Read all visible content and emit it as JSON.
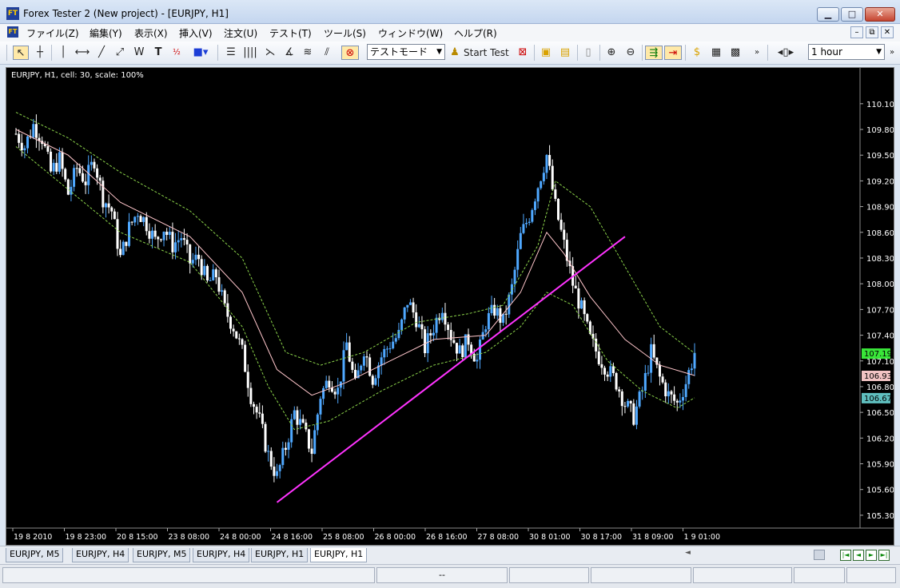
{
  "window": {
    "title": "Forex Tester 2  (New project) - [EURJPY, H1]",
    "app_icon_text": "FT",
    "buttons": {
      "minimize": "▁",
      "maximize": "□",
      "close": "✕"
    }
  },
  "menu": {
    "items": [
      "ファイル(Z)",
      "編集(Y)",
      "表示(X)",
      "挿入(V)",
      "注文(U)",
      "テスト(T)",
      "ツール(S)",
      "ウィンドウ(W)",
      "ヘルプ(R)"
    ],
    "mdi_buttons": [
      "–",
      "⧉",
      "✕"
    ]
  },
  "toolbar": {
    "text_tool_label": "T",
    "mode_select": "テストモード",
    "start_test_label": "Start Test",
    "timeframe_select": "1 hour"
  },
  "chart": {
    "info": "EURJPY, H1, cell: 30, scale: 100%"
  },
  "chart_data": {
    "type": "candlestick",
    "symbol": "EURJPY",
    "timeframe": "H1",
    "y_ticks": [
      "110.10",
      "109.80",
      "109.50",
      "109.20",
      "108.90",
      "108.60",
      "108.30",
      "108.00",
      "107.70",
      "107.40",
      "107.10",
      "106.80",
      "106.50",
      "106.20",
      "105.90",
      "105.60",
      "105.30"
    ],
    "ylim": [
      105.15,
      110.35
    ],
    "x_ticks": [
      "19 8 2010",
      "19 8 23:00",
      "20 8 15:00",
      "23 8 08:00",
      "24 8 00:00",
      "24 8 16:00",
      "25 8 08:00",
      "26 8 00:00",
      "26 8 16:00",
      "27 8 08:00",
      "30 8 01:00",
      "30 8 17:00",
      "31 8 09:00",
      "1 9 01:00"
    ],
    "price_labels": [
      {
        "text": "107.19",
        "value": 107.19,
        "color": "#39e639"
      },
      {
        "text": "106.93",
        "value": 106.93,
        "color": "#f2c4c4"
      },
      {
        "text": "106.67",
        "value": 106.67,
        "color": "#5fbfbf"
      }
    ],
    "close_path": [
      [
        0,
        109.75
      ],
      [
        1,
        109.6
      ],
      [
        2,
        109.85
      ],
      [
        3,
        109.7
      ],
      [
        4,
        109.3
      ],
      [
        5,
        109.45
      ],
      [
        6,
        109.05
      ],
      [
        7,
        109.35
      ],
      [
        8,
        109.2
      ],
      [
        9,
        109.45
      ],
      [
        10,
        109.0
      ],
      [
        11,
        108.85
      ],
      [
        12,
        108.3
      ],
      [
        13,
        108.65
      ],
      [
        14,
        108.85
      ],
      [
        15,
        108.7
      ],
      [
        16,
        108.5
      ],
      [
        17,
        108.65
      ],
      [
        18,
        108.45
      ],
      [
        19,
        108.55
      ],
      [
        20,
        108.25
      ],
      [
        21,
        108.3
      ],
      [
        22,
        108.0
      ],
      [
        23,
        108.1
      ],
      [
        24,
        107.7
      ],
      [
        25,
        107.5
      ],
      [
        26,
        107.2
      ],
      [
        27,
        106.7
      ],
      [
        28,
        106.4
      ],
      [
        29,
        106.0
      ],
      [
        30,
        105.75
      ],
      [
        31,
        106.1
      ],
      [
        32,
        106.5
      ],
      [
        33,
        106.3
      ],
      [
        34,
        106.05
      ],
      [
        35,
        106.7
      ],
      [
        36,
        106.9
      ],
      [
        37,
        106.75
      ],
      [
        38,
        107.3
      ],
      [
        39,
        106.8
      ],
      [
        40,
        107.25
      ],
      [
        41,
        106.9
      ],
      [
        42,
        107.15
      ],
      [
        43,
        107.3
      ],
      [
        44,
        107.4
      ],
      [
        45,
        107.8
      ],
      [
        46,
        107.6
      ],
      [
        47,
        107.25
      ],
      [
        48,
        107.5
      ],
      [
        49,
        107.75
      ],
      [
        50,
        107.4
      ],
      [
        51,
        107.2
      ],
      [
        52,
        107.35
      ],
      [
        53,
        107.1
      ],
      [
        54,
        107.55
      ],
      [
        55,
        107.7
      ],
      [
        56,
        107.55
      ],
      [
        57,
        107.95
      ],
      [
        58,
        108.55
      ],
      [
        59,
        108.8
      ],
      [
        60,
        109.15
      ],
      [
        61,
        109.5
      ],
      [
        62,
        108.9
      ],
      [
        63,
        108.45
      ],
      [
        64,
        108.0
      ],
      [
        65,
        107.7
      ],
      [
        66,
        107.35
      ],
      [
        67,
        107.15
      ],
      [
        68,
        107.0
      ],
      [
        69,
        106.85
      ],
      [
        70,
        106.6
      ],
      [
        71,
        106.45
      ],
      [
        72,
        106.75
      ],
      [
        73,
        107.2
      ],
      [
        74,
        106.9
      ],
      [
        75,
        106.7
      ],
      [
        76,
        106.6
      ],
      [
        77,
        106.85
      ],
      [
        78,
        107.2
      ]
    ],
    "moving_average": [
      [
        0,
        109.8
      ],
      [
        6,
        109.5
      ],
      [
        12,
        108.95
      ],
      [
        20,
        108.55
      ],
      [
        26,
        107.9
      ],
      [
        30,
        107.0
      ],
      [
        34,
        106.7
      ],
      [
        38,
        106.85
      ],
      [
        42,
        107.05
      ],
      [
        48,
        107.35
      ],
      [
        54,
        107.4
      ],
      [
        58,
        107.9
      ],
      [
        61,
        108.6
      ],
      [
        63,
        108.35
      ],
      [
        66,
        107.85
      ],
      [
        70,
        107.35
      ],
      [
        74,
        107.05
      ],
      [
        78,
        106.93
      ]
    ],
    "band_upper": [
      [
        0,
        110.0
      ],
      [
        6,
        109.7
      ],
      [
        12,
        109.3
      ],
      [
        20,
        108.85
      ],
      [
        26,
        108.3
      ],
      [
        31,
        107.2
      ],
      [
        35,
        107.05
      ],
      [
        40,
        107.2
      ],
      [
        46,
        107.55
      ],
      [
        52,
        107.65
      ],
      [
        56,
        107.75
      ],
      [
        60,
        108.45
      ],
      [
        62,
        109.2
      ],
      [
        66,
        108.9
      ],
      [
        70,
        108.2
      ],
      [
        74,
        107.5
      ],
      [
        78,
        107.19
      ]
    ],
    "band_lower": [
      [
        0,
        109.6
      ],
      [
        6,
        109.1
      ],
      [
        12,
        108.6
      ],
      [
        20,
        108.25
      ],
      [
        26,
        107.5
      ],
      [
        29,
        106.8
      ],
      [
        32,
        106.3
      ],
      [
        36,
        106.4
      ],
      [
        42,
        106.75
      ],
      [
        48,
        107.05
      ],
      [
        54,
        107.2
      ],
      [
        58,
        107.5
      ],
      [
        61,
        107.9
      ],
      [
        64,
        107.75
      ],
      [
        68,
        107.1
      ],
      [
        72,
        106.75
      ],
      [
        76,
        106.55
      ],
      [
        78,
        106.67
      ]
    ],
    "trendline": {
      "start": [
        30,
        105.45
      ],
      "end": [
        70,
        108.55
      ],
      "color": "#ff33ff"
    },
    "colors": {
      "background": "#000000",
      "bull": "#4fa8ff",
      "bear": "#ffffff",
      "ma": "#ffc6cb",
      "band": "#8bd34a"
    }
  },
  "tabs": [
    {
      "label": "EURJPY, M5",
      "active": false
    },
    {
      "label": "EURJPY, H4",
      "active": false
    },
    {
      "label": "EURJPY, M5",
      "active": false
    },
    {
      "label": "EURJPY, H4",
      "active": false
    },
    {
      "label": "EURJPY, H1",
      "active": false
    },
    {
      "label": "EURJPY, H1",
      "active": true
    }
  ],
  "statusbar": {
    "center_text": "--"
  }
}
